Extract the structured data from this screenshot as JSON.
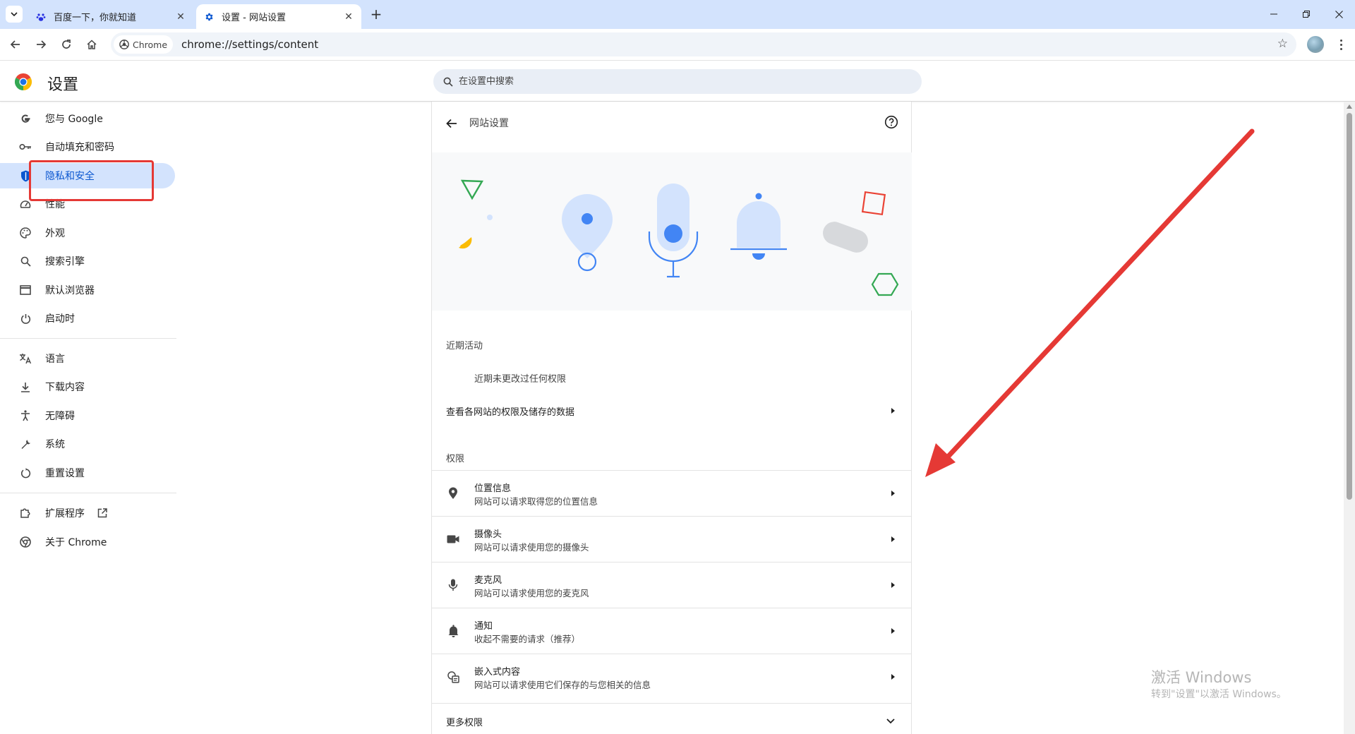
{
  "browser": {
    "tabs": [
      {
        "title": "百度一下，你就知道",
        "active": false,
        "icon": "baidu-paw-icon"
      },
      {
        "title": "设置 - 网站设置",
        "active": true,
        "icon": "gear-icon"
      }
    ],
    "omnibox": {
      "chip_label": "Chrome",
      "url": "chrome://settings/content"
    },
    "accent": "#d3e3fd"
  },
  "settings": {
    "title": "设置",
    "search": {
      "placeholder": "在设置中搜索"
    },
    "sidebar": {
      "items": [
        {
          "label": "您与 Google",
          "icon": "google-g-icon"
        },
        {
          "label": "自动填充和密码",
          "icon": "key-icon"
        },
        {
          "label": "隐私和安全",
          "icon": "shield-icon",
          "selected": true
        },
        {
          "label": "性能",
          "icon": "speedometer-icon"
        },
        {
          "label": "外观",
          "icon": "palette-icon"
        },
        {
          "label": "搜索引擎",
          "icon": "search-icon"
        },
        {
          "label": "默认浏览器",
          "icon": "browser-window-icon"
        },
        {
          "label": "启动时",
          "icon": "power-icon"
        },
        {
          "label": "语言",
          "icon": "translate-icon"
        },
        {
          "label": "下载内容",
          "icon": "download-icon"
        },
        {
          "label": "无障碍",
          "icon": "accessibility-icon"
        },
        {
          "label": "系统",
          "icon": "wrench-icon"
        },
        {
          "label": "重置设置",
          "icon": "reset-icon"
        },
        {
          "label": "扩展程序",
          "icon": "puzzle-icon"
        },
        {
          "label": "关于 Chrome",
          "icon": "chrome-icon"
        }
      ]
    },
    "site_settings": {
      "title": "网站设置",
      "recent_label": "近期活动",
      "recent_empty": "近期未更改过任何权限",
      "view_all_link": "查看各网站的权限及储存的数据",
      "permissions_label": "权限",
      "permissions": [
        {
          "name": "位置信息",
          "desc": "网站可以请求取得您的位置信息",
          "icon": "location-pin-icon"
        },
        {
          "name": "摄像头",
          "desc": "网站可以请求使用您的摄像头",
          "icon": "camera-icon"
        },
        {
          "name": "麦克风",
          "desc": "网站可以请求使用您的麦克风",
          "icon": "microphone-icon"
        },
        {
          "name": "通知",
          "desc": "收起不需要的请求（推荐）",
          "icon": "bell-icon"
        },
        {
          "name": "嵌入式内容",
          "desc": "网站可以请求使用它们保存的与您相关的信息",
          "icon": "embedded-content-icon"
        }
      ],
      "more_label": "更多权限"
    }
  },
  "watermark": {
    "title": "激活 Windows",
    "subtitle": "转到\"设置\"以激活 Windows。"
  },
  "annotation_color": "#e53935"
}
